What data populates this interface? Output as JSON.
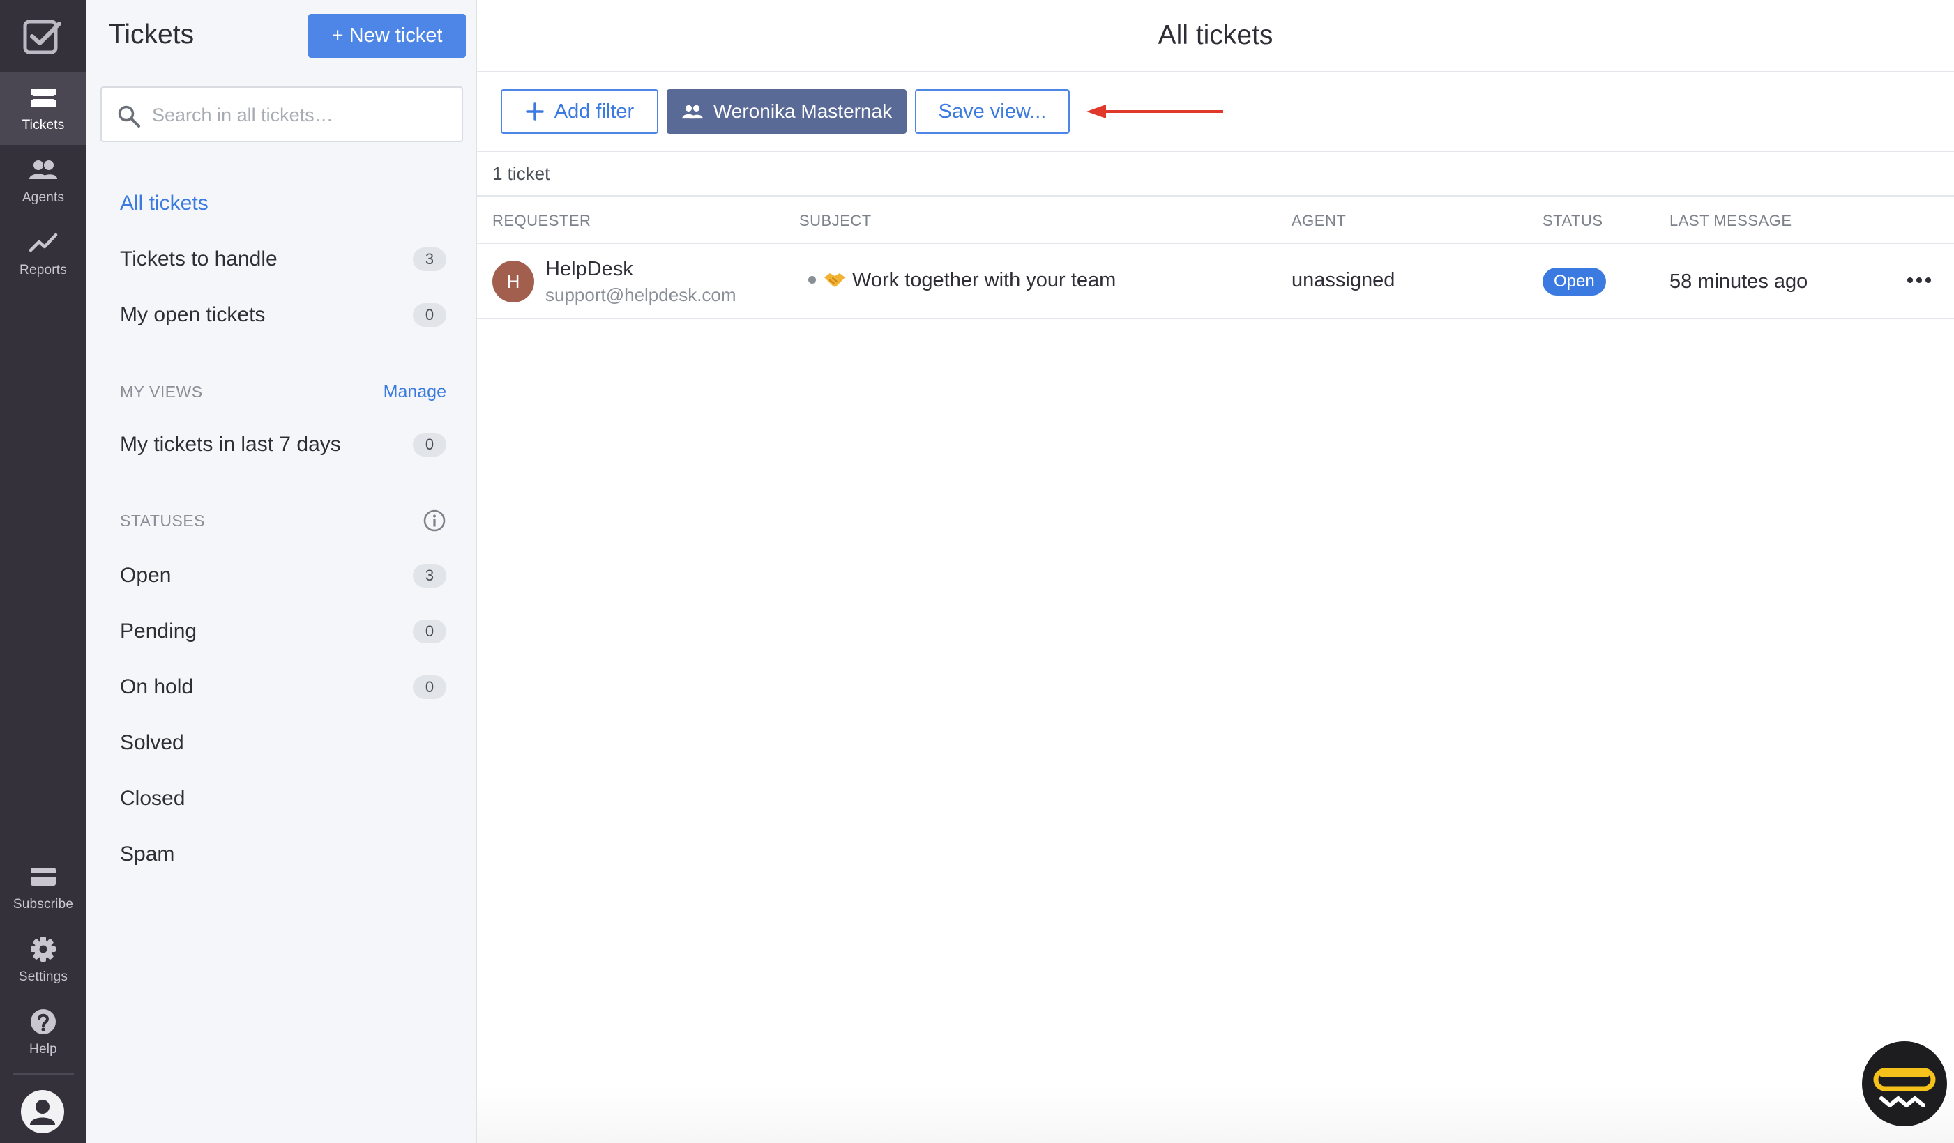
{
  "rail": {
    "items": [
      {
        "label": "Tickets",
        "icon": "ticket-icon"
      },
      {
        "label": "Agents",
        "icon": "agents-icon"
      },
      {
        "label": "Reports",
        "icon": "reports-icon"
      }
    ],
    "bottom_items": [
      {
        "label": "Subscribe",
        "icon": "card-icon"
      },
      {
        "label": "Settings",
        "icon": "gear-icon"
      },
      {
        "label": "Help",
        "icon": "help-icon"
      }
    ]
  },
  "sidebar": {
    "title": "Tickets",
    "new_ticket_label": "+ New ticket",
    "search_placeholder": "Search in all tickets…",
    "nav": [
      {
        "label": "All tickets",
        "count": ""
      },
      {
        "label": "Tickets to handle",
        "count": "3"
      },
      {
        "label": "My open tickets",
        "count": "0"
      }
    ],
    "my_views_heading": "MY VIEWS",
    "manage_label": "Manage",
    "views": [
      {
        "label": "My tickets in last 7 days",
        "count": "0"
      }
    ],
    "statuses_heading": "STATUSES",
    "statuses": [
      {
        "label": "Open",
        "count": "3"
      },
      {
        "label": "Pending",
        "count": "0"
      },
      {
        "label": "On hold",
        "count": "0"
      },
      {
        "label": "Solved",
        "count": ""
      },
      {
        "label": "Closed",
        "count": ""
      },
      {
        "label": "Spam",
        "count": ""
      }
    ]
  },
  "main": {
    "title": "All tickets",
    "toolbar": {
      "add_filter_label": "Add filter",
      "agent_filter_label": "Weronika Masternak",
      "save_view_label": "Save view..."
    },
    "ticket_count": "1 ticket",
    "columns": [
      "REQUESTER",
      "SUBJECT",
      "AGENT",
      "STATUS",
      "LAST MESSAGE"
    ],
    "rows": [
      {
        "avatar_letter": "H",
        "requester_name": "HelpDesk",
        "requester_email": "support@helpdesk.com",
        "subject": "Work together with your team",
        "agent": "unassigned",
        "status": "Open",
        "last_message": "58 minutes ago"
      }
    ]
  },
  "colors": {
    "rail_bg": "#34313b",
    "accent": "#4e86e8",
    "agent_filter_bg": "#5a6a96",
    "annotation_arrow": "#e0392b",
    "avatar_bg": "#a35f4e"
  }
}
